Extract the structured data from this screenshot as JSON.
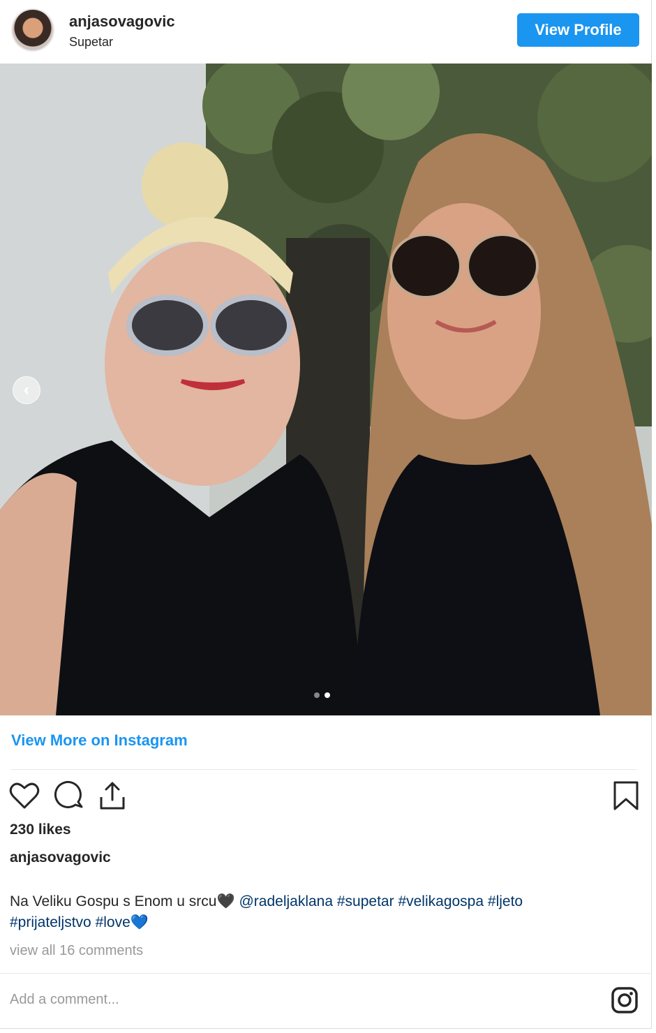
{
  "post": {
    "username": "anjasovagovic",
    "location": "Supetar",
    "view_profile_label": "View Profile",
    "view_more_label": "View More on Instagram",
    "likes": "230 likes",
    "caption_author": "anjasovagovic",
    "caption": {
      "text": "Na Veliku Gospu s Enom u srcu🖤",
      "mention": "@radeljaklana",
      "tags": [
        "#supetar",
        "#velikagospa",
        "#ljeto",
        "#prijateljstvo",
        "#love💙"
      ]
    },
    "view_comments_label": "view all 16 comments",
    "add_comment_placeholder": "Add a comment...",
    "carousel": {
      "total": 2,
      "active_index": 1
    }
  },
  "icons": {
    "like": "heart-icon",
    "comment": "comment-icon",
    "share": "share-icon",
    "save": "bookmark-icon",
    "brand": "instagram-icon",
    "prev": "chevron-left-icon"
  },
  "colors": {
    "accent": "#1a95f0",
    "link": "#003569",
    "muted": "#999999",
    "text": "#262626"
  }
}
